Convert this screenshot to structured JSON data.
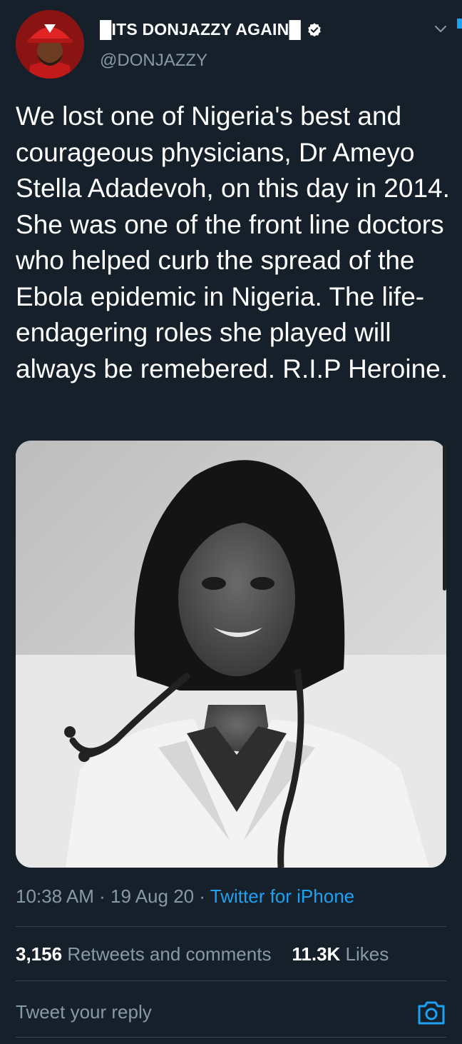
{
  "tweet": {
    "display_name": "█ITS DONJAZZY AGAIN█",
    "handle": "@DONJAZZY",
    "text": "We lost one of Nigeria's best and courageous physicians, Dr Ameyo Stella Adadevoh, on this day in 2014. She was one of the front line doctors who helped curb the spread of the Ebola epidemic in Nigeria. The life-endagering roles she played will always be remebered. R.I.P Heroine.",
    "time": "10:38 AM",
    "date": "19 Aug 20",
    "separator": "·",
    "source": "Twitter for iPhone"
  },
  "stats": {
    "retweets_count": "3,156",
    "retweets_label": "Retweets and comments",
    "likes_count": "11.3K",
    "likes_label": "Likes"
  },
  "reply": {
    "placeholder": "Tweet your reply"
  },
  "icons": {
    "verified": "verified-badge-icon",
    "menu": "chevron-down-icon",
    "camera": "camera-icon"
  },
  "colors": {
    "background": "#15202b",
    "accent": "#1da1f2",
    "secondary_text": "#8899a6",
    "avatar_cap": "#d01c1c"
  }
}
